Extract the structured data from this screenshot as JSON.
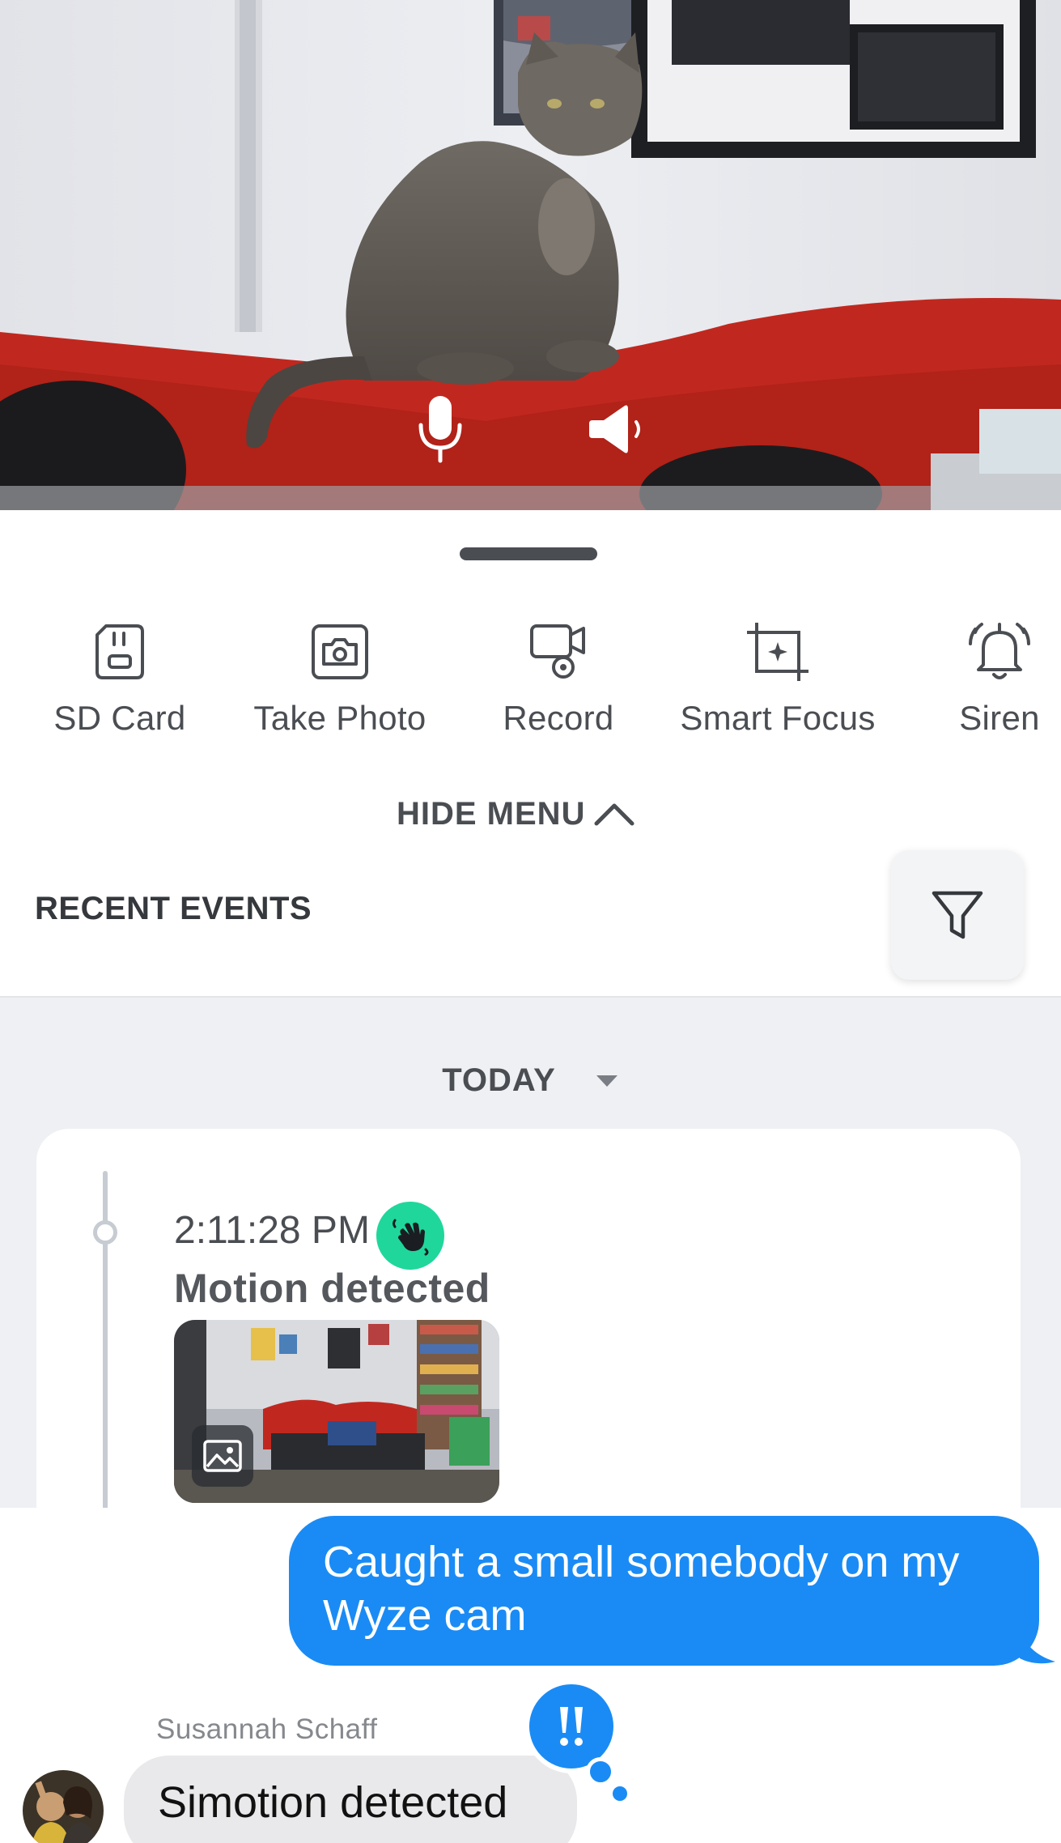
{
  "live_view": {
    "controls": [
      {
        "name": "microphone-icon"
      },
      {
        "name": "speaker-icon"
      }
    ]
  },
  "menu": {
    "items": [
      {
        "label": "SD Card",
        "icon": "sd-card-icon"
      },
      {
        "label": "Take Photo",
        "icon": "camera-icon"
      },
      {
        "label": "Record",
        "icon": "record-icon"
      },
      {
        "label": "Smart Focus",
        "icon": "smart-focus-icon"
      },
      {
        "label": "Siren",
        "icon": "siren-icon"
      }
    ],
    "hide_label": "HIDE MENU"
  },
  "recent_events": {
    "title": "RECENT EVENTS",
    "filter_icon": "filter-icon"
  },
  "events": {
    "day_label": "TODAY",
    "items": [
      {
        "time": "2:11:28 PM",
        "title": "Motion detected",
        "badge_icon": "motion-hand-icon",
        "thumb_icon": "photo-icon"
      }
    ]
  },
  "messages": {
    "outgoing": "Caught a small somebody on my Wyze cam",
    "sender": "Susannah Schaff",
    "incoming": "Simotion detected",
    "tapback_icon": "exclamation-tapback-icon",
    "colors": {
      "outgoing_bubble": "#1a8bf5",
      "incoming_bubble": "#e9e9eb"
    }
  },
  "colors": {
    "motion_badge": "#1fd79b",
    "events_bg": "#eef0f3"
  }
}
